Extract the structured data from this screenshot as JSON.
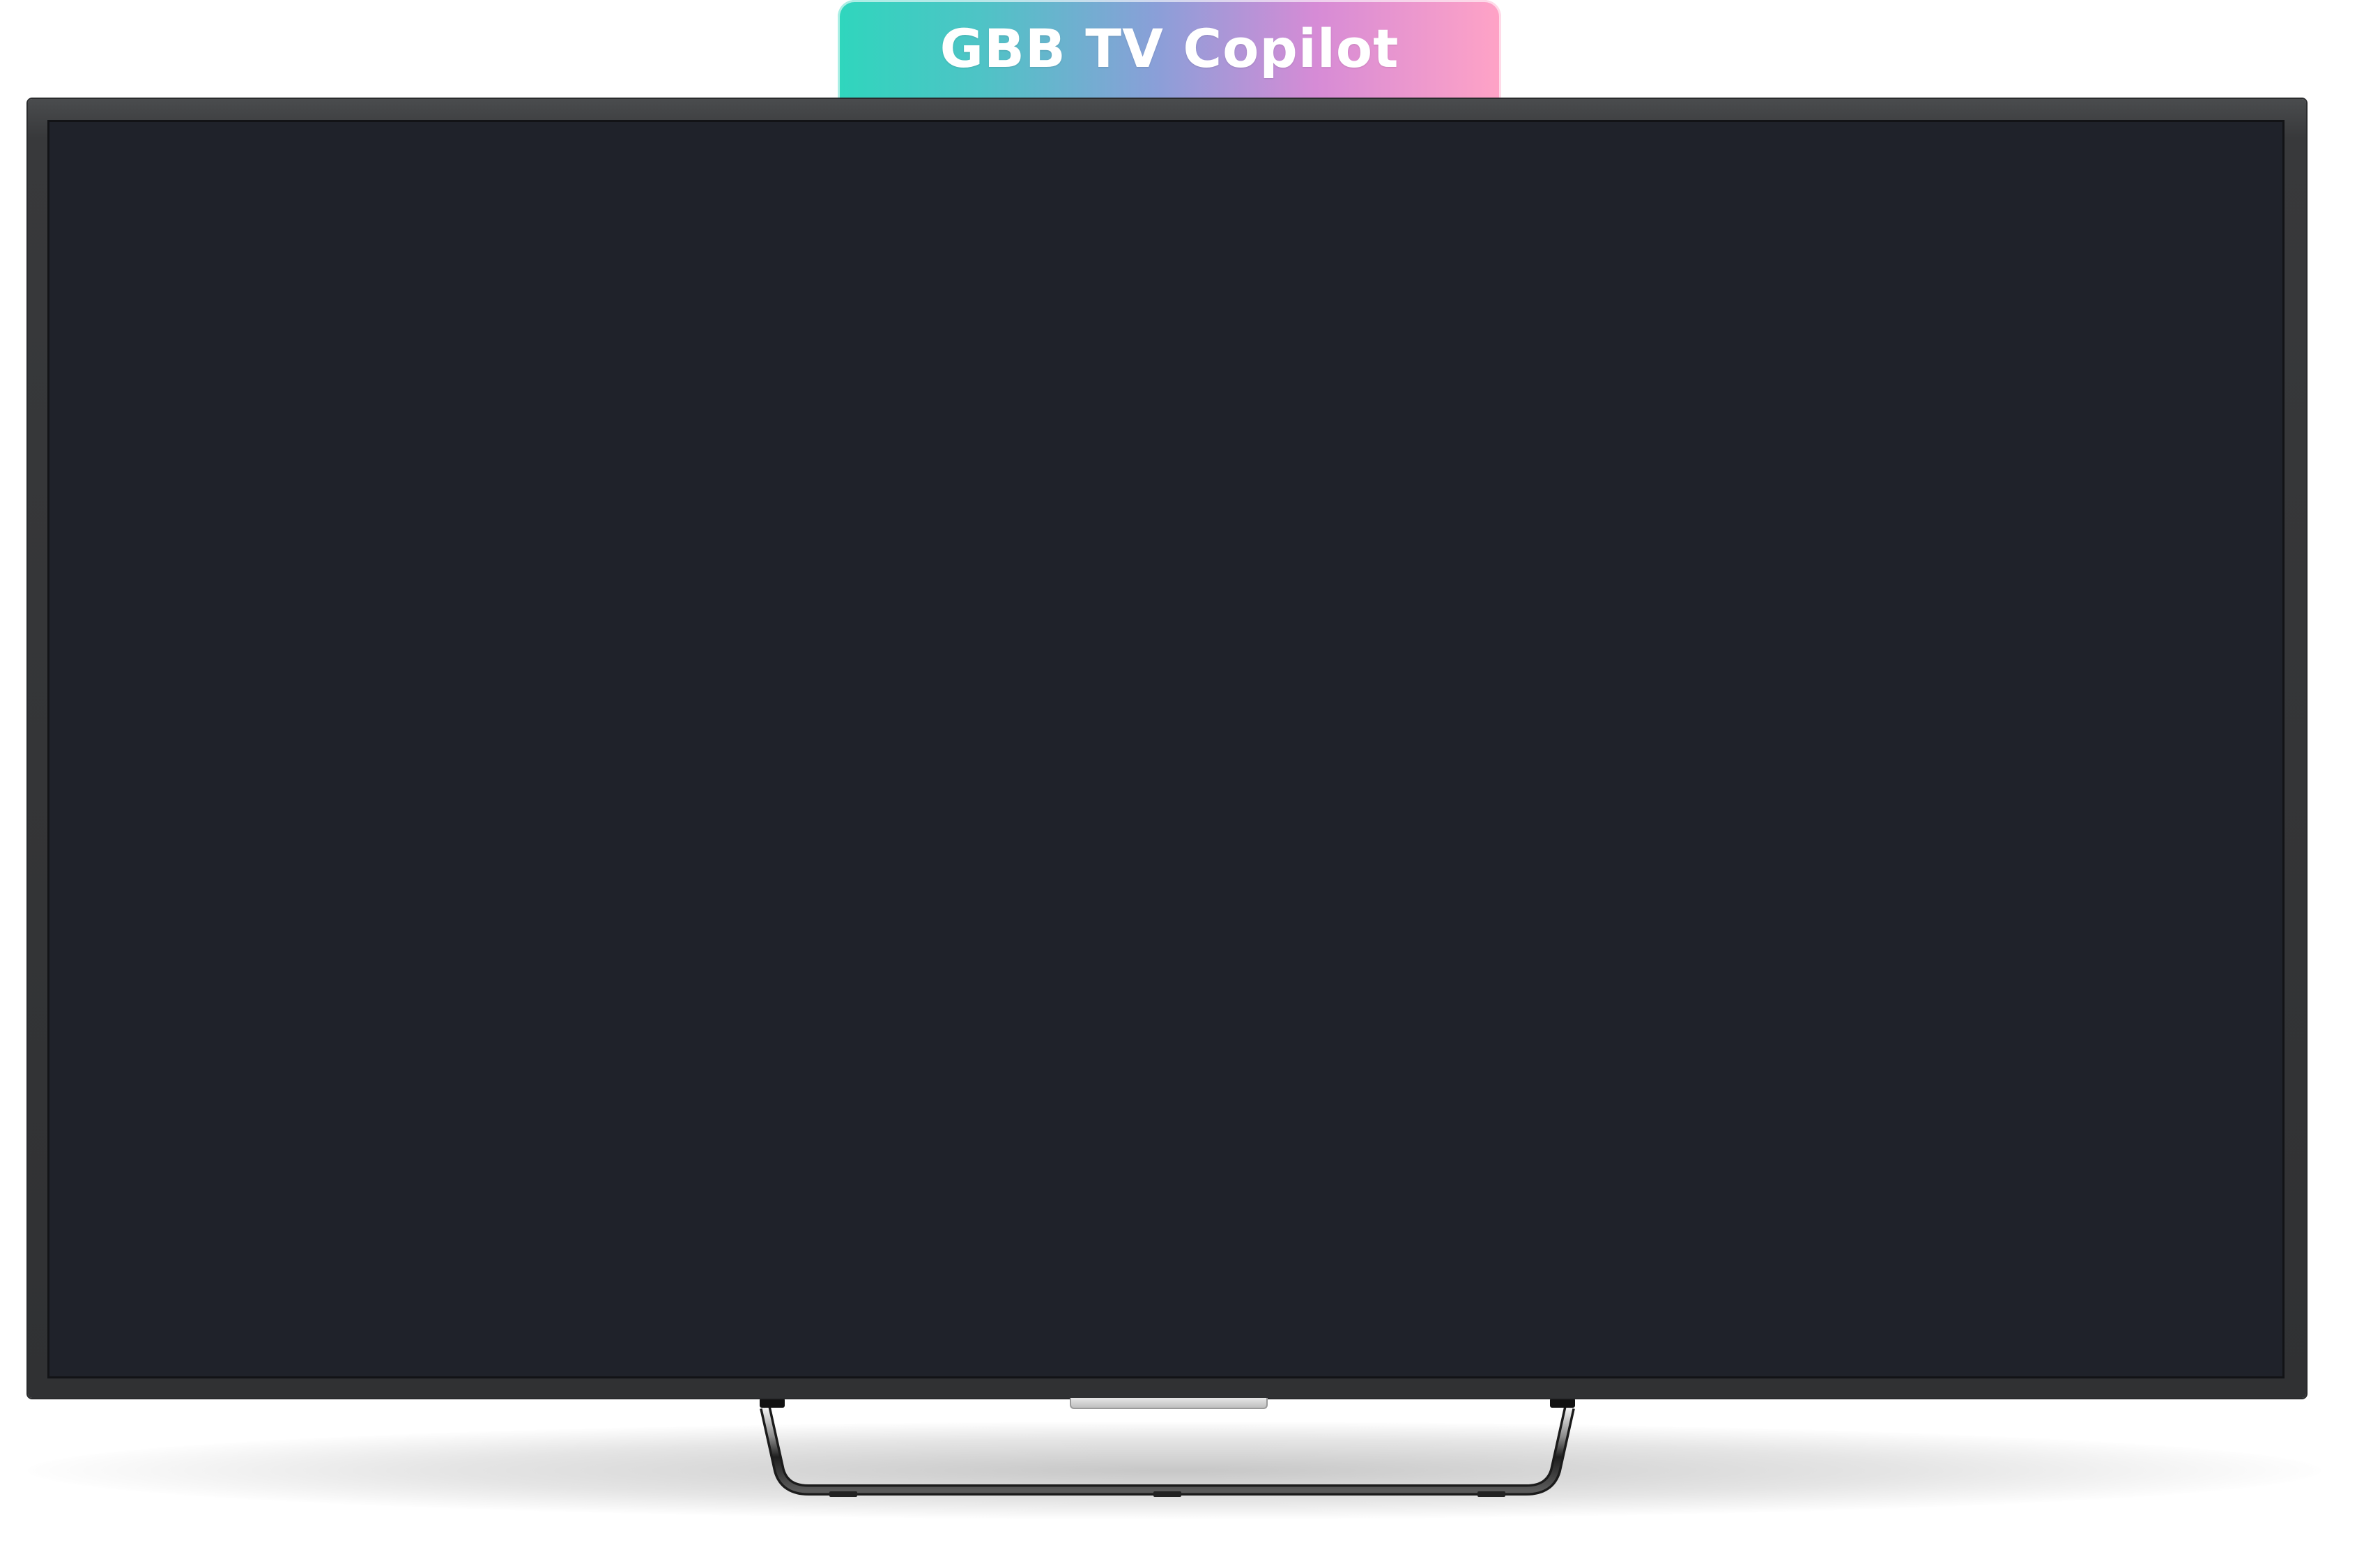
{
  "app": {
    "title": "GBB TV Copilot"
  },
  "colors": {
    "gradient_start": "#2fd6bd",
    "gradient_mid": "#8a9fd8",
    "gradient_end": "#ffa3c6",
    "screen": "#1f222a",
    "bezel": "#303133"
  },
  "icons": {
    "device": "tv-icon"
  }
}
